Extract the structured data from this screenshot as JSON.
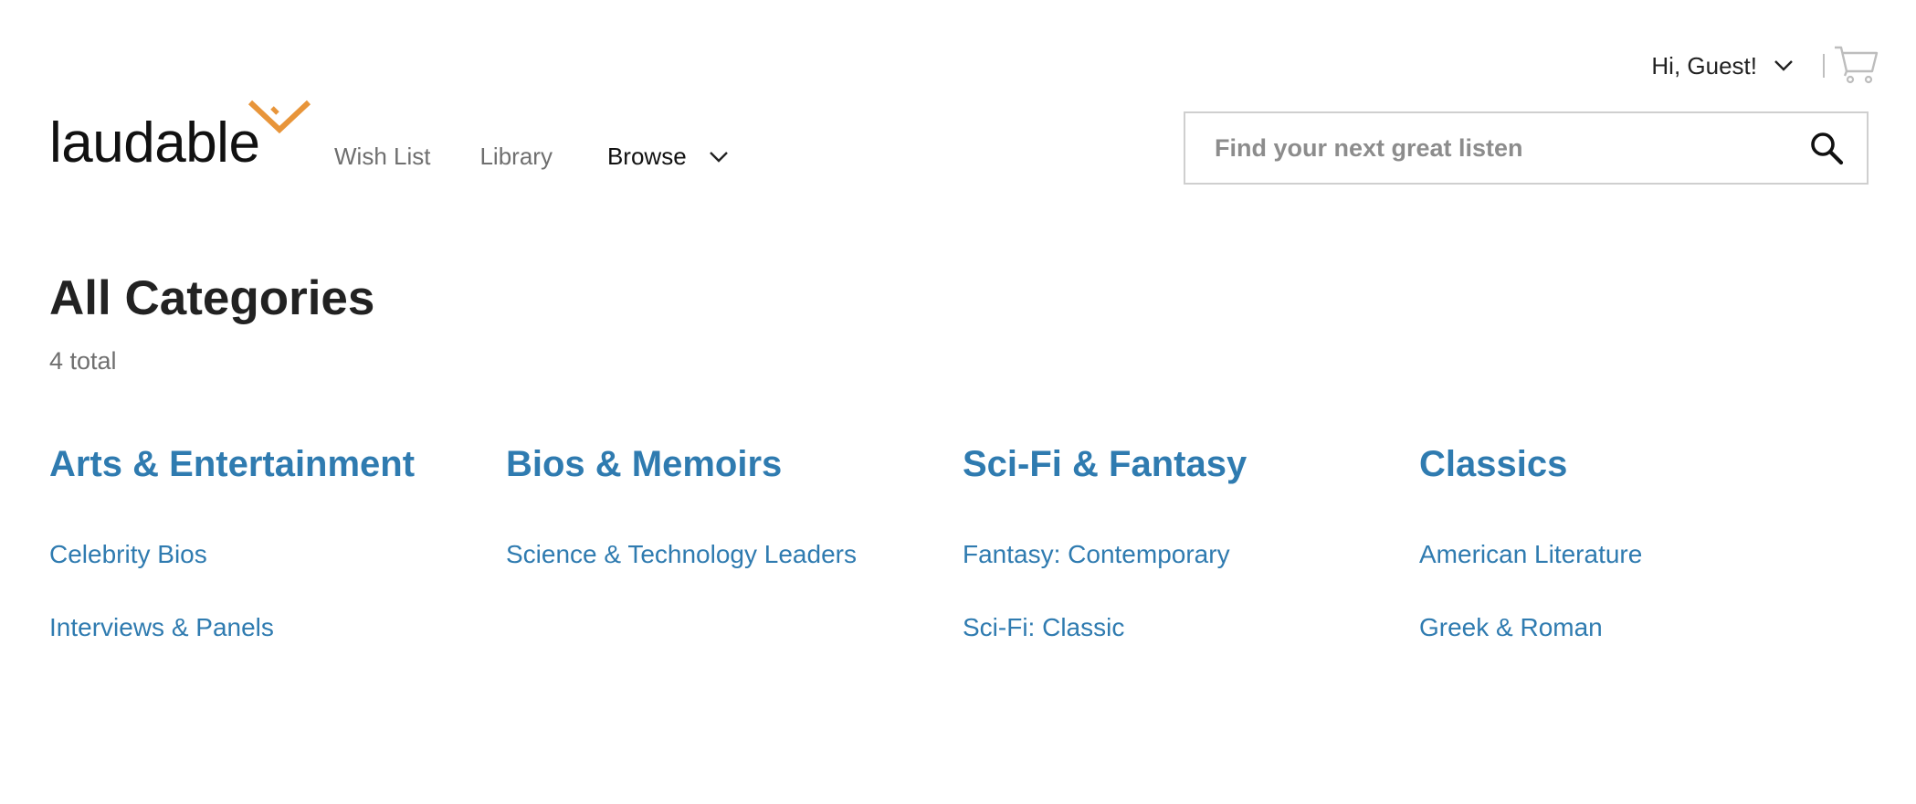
{
  "header": {
    "logo_text": "laudable",
    "greeting": "Hi, Guest!",
    "nav": {
      "wish_list": "Wish List",
      "library": "Library",
      "browse": "Browse"
    },
    "search": {
      "placeholder": "Find your next great listen",
      "value": ""
    }
  },
  "colors": {
    "accent": "#e8953a",
    "link": "#2f7bb0"
  },
  "main": {
    "title": "All Categories",
    "total": "4 total",
    "categories": [
      {
        "title": "Arts & Entertainment",
        "links": [
          "Celebrity Bios",
          "Interviews & Panels"
        ]
      },
      {
        "title": "Bios & Memoirs",
        "links": [
          "Science & Technology Leaders"
        ]
      },
      {
        "title": "Sci-Fi & Fantasy",
        "links": [
          "Fantasy: Contemporary",
          "Sci-Fi: Classic"
        ]
      },
      {
        "title": "Classics",
        "links": [
          "American Literature",
          "Greek & Roman"
        ]
      }
    ]
  },
  "icons": [
    "laudable-logo-mark-icon",
    "chevron-down-icon",
    "cart-icon",
    "search-icon"
  ]
}
